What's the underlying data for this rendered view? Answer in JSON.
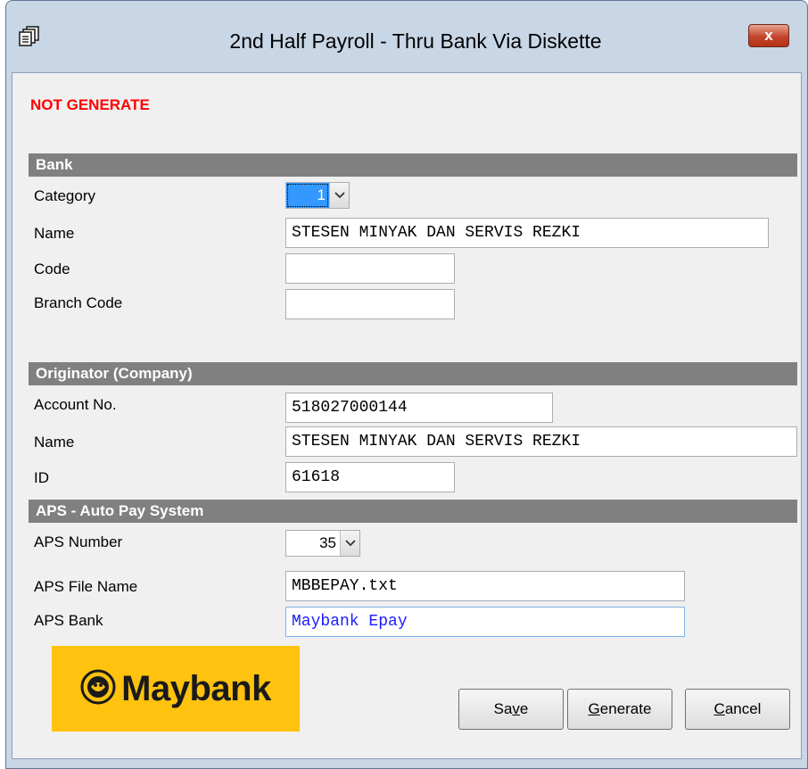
{
  "window": {
    "title": "2nd Half Payroll - Thru Bank Via Diskette",
    "close_label": "x"
  },
  "status": "NOT GENERATE",
  "bank": {
    "header": "Bank",
    "category_label": "Category",
    "category_value": "1",
    "name_label": "Name",
    "name_value": "STESEN MINYAK DAN SERVIS REZKI",
    "code_label": "Code",
    "code_value": "",
    "branch_code_label": "Branch Code",
    "branch_code_value": ""
  },
  "originator": {
    "header": "Originator (Company)",
    "account_label": "Account No.",
    "account_value": "518027000144",
    "name_label": "Name",
    "name_value": "STESEN MINYAK DAN SERVIS REZKI",
    "id_label": "ID",
    "id_value": "61618"
  },
  "aps": {
    "header": "APS - Auto Pay System",
    "number_label": "APS Number",
    "number_value": "35",
    "file_name_label": "APS File Name",
    "file_name_value": "MBBEPAY.txt",
    "bank_label": "APS Bank",
    "bank_value": "Maybank Epay"
  },
  "logo": {
    "text": "Maybank",
    "color": "#ffc20e"
  },
  "buttons": {
    "save": {
      "pre": "Sa",
      "accel": "v",
      "post": "e"
    },
    "generate": {
      "pre": "",
      "accel": "G",
      "post": "enerate"
    },
    "cancel": {
      "pre": "",
      "accel": "C",
      "post": "ancel"
    }
  },
  "icons": {
    "app": "stacked-documents-icon",
    "close": "close-icon",
    "dropdown": "chevron-down-icon",
    "logo": "tiger-emblem-icon"
  }
}
